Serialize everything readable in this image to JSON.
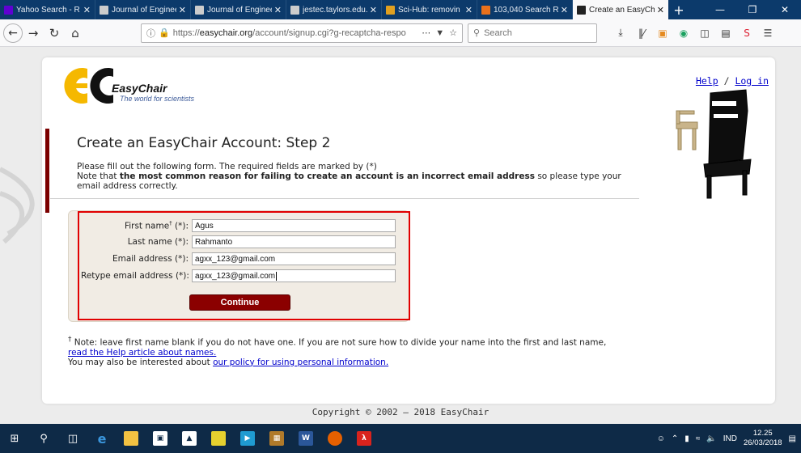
{
  "browser": {
    "tabs": [
      {
        "title": "Yahoo Search - R",
        "favicon": "yahoo-icon",
        "color": "#6001d2"
      },
      {
        "title": "Journal of Engineerin",
        "favicon": "page-icon",
        "color": "#cccccc"
      },
      {
        "title": "Journal of Engineerin",
        "favicon": "page-icon",
        "color": "#cccccc"
      },
      {
        "title": "jestec.taylors.edu.my/",
        "favicon": "page-icon",
        "color": "#cccccc"
      },
      {
        "title": "Sci-Hub: removin",
        "favicon": "scihub-icon",
        "color": "#e0a020"
      },
      {
        "title": "103,040 Search R",
        "favicon": "elsevier-icon",
        "color": "#e9711c"
      },
      {
        "title": "Create an EasyCh",
        "favicon": "easychair-icon",
        "color": "#222222",
        "active": true
      }
    ],
    "url_prefix": "https://",
    "url_host": "easychair.org",
    "url_path": "/account/signup.cgi?g-recaptcha-respo",
    "search_placeholder": "Search"
  },
  "page": {
    "logo_brand": "EasyChair",
    "logo_tagline": "The world for scientists",
    "help_link": "Help",
    "links_separator": "/",
    "login_link": "Log in",
    "heading": "Create an EasyChair Account: Step 2",
    "intro_line1": "Please fill out the following form. The required fields are marked by (*)",
    "intro_line2_pre": "Note that ",
    "intro_line2_bold": "the most common reason for failing to create an account is an incorrect email address",
    "intro_line2_post": " so please type your email address correctly.",
    "form": {
      "first_name_label": "First name",
      "first_name_dagger": "†",
      "first_name_suffix": " (*):",
      "first_name_value": "Agus",
      "last_name_label": "Last name (*):",
      "last_name_value": "Rahmanto",
      "email_label": "Email address (*):",
      "email_value": "agxx_123@gmail.com",
      "retype_email_label": "Retype email address (*):",
      "retype_email_value": "agxx_123@gmail.com",
      "continue_label": "Continue"
    },
    "note_dagger": "†",
    "note_text": " Note: leave first name blank if you do not have one. If you are not sure how to divide your name into the first and last name,",
    "note_link": "read the Help article about names.",
    "policy_pre": "You may also be interested about ",
    "policy_link": "our policy for using personal information.",
    "copyright": "Copyright © 2002 – 2018 EasyChair"
  },
  "taskbar": {
    "language": "IND",
    "time": "12.25",
    "date": "26/03/2018"
  },
  "colors": {
    "accent_red": "#8b0000",
    "highlight_border": "#e10000",
    "link_blue": "#0000cc"
  }
}
